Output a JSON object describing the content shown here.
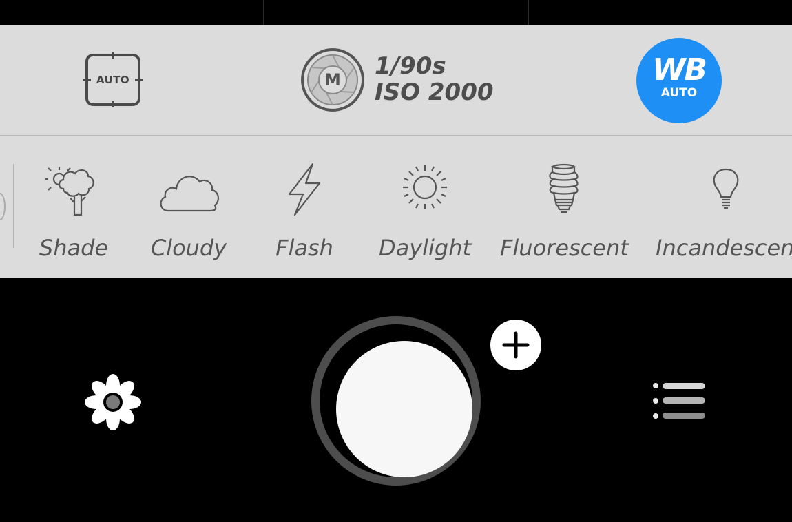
{
  "focus": {
    "label": "AUTO",
    "icon": "focus-frame-icon"
  },
  "exposure": {
    "mode": "M",
    "shutter_speed": "1/90s",
    "iso": "ISO 2000",
    "icon": "aperture-icon"
  },
  "white_balance": {
    "title": "WB",
    "mode": "AUTO",
    "color": "#1e90f5"
  },
  "presets": [
    {
      "label": "Shade",
      "icon": "shade-tree-icon"
    },
    {
      "label": "Cloudy",
      "icon": "cloud-icon"
    },
    {
      "label": "Flash",
      "icon": "flash-icon"
    },
    {
      "label": "Daylight",
      "icon": "sun-icon"
    },
    {
      "label": "Fluorescent",
      "icon": "fluorescent-bulb-icon"
    },
    {
      "label": "Incandescent",
      "icon": "incandescent-bulb-icon"
    }
  ],
  "bottom": {
    "left_icon": "flower-icon",
    "shutter": "shutter-button",
    "plus_icon": "plus-icon",
    "right_icon": "list-menu-icon"
  }
}
